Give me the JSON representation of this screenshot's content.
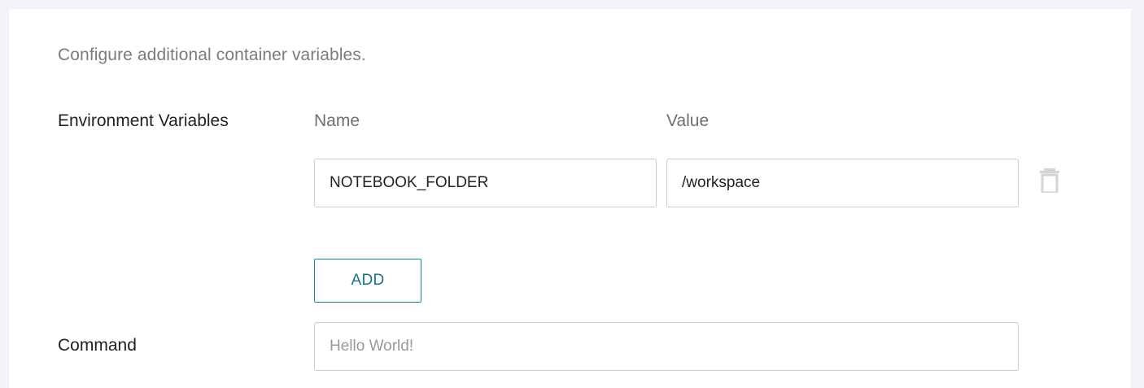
{
  "form": {
    "description": "Configure additional container variables.",
    "env_section": {
      "label": "Environment Variables",
      "name_header": "Name",
      "value_header": "Value",
      "rows": [
        {
          "name": "NOTEBOOK_FOLDER",
          "value": "/workspace"
        }
      ],
      "add_label": "ADD"
    },
    "command": {
      "label": "Command",
      "placeholder": "Hello World!",
      "value": ""
    }
  },
  "colors": {
    "accent": "#1a7388",
    "icon_muted": "#cfcfcf"
  },
  "icons": {
    "delete": "trash-icon"
  }
}
